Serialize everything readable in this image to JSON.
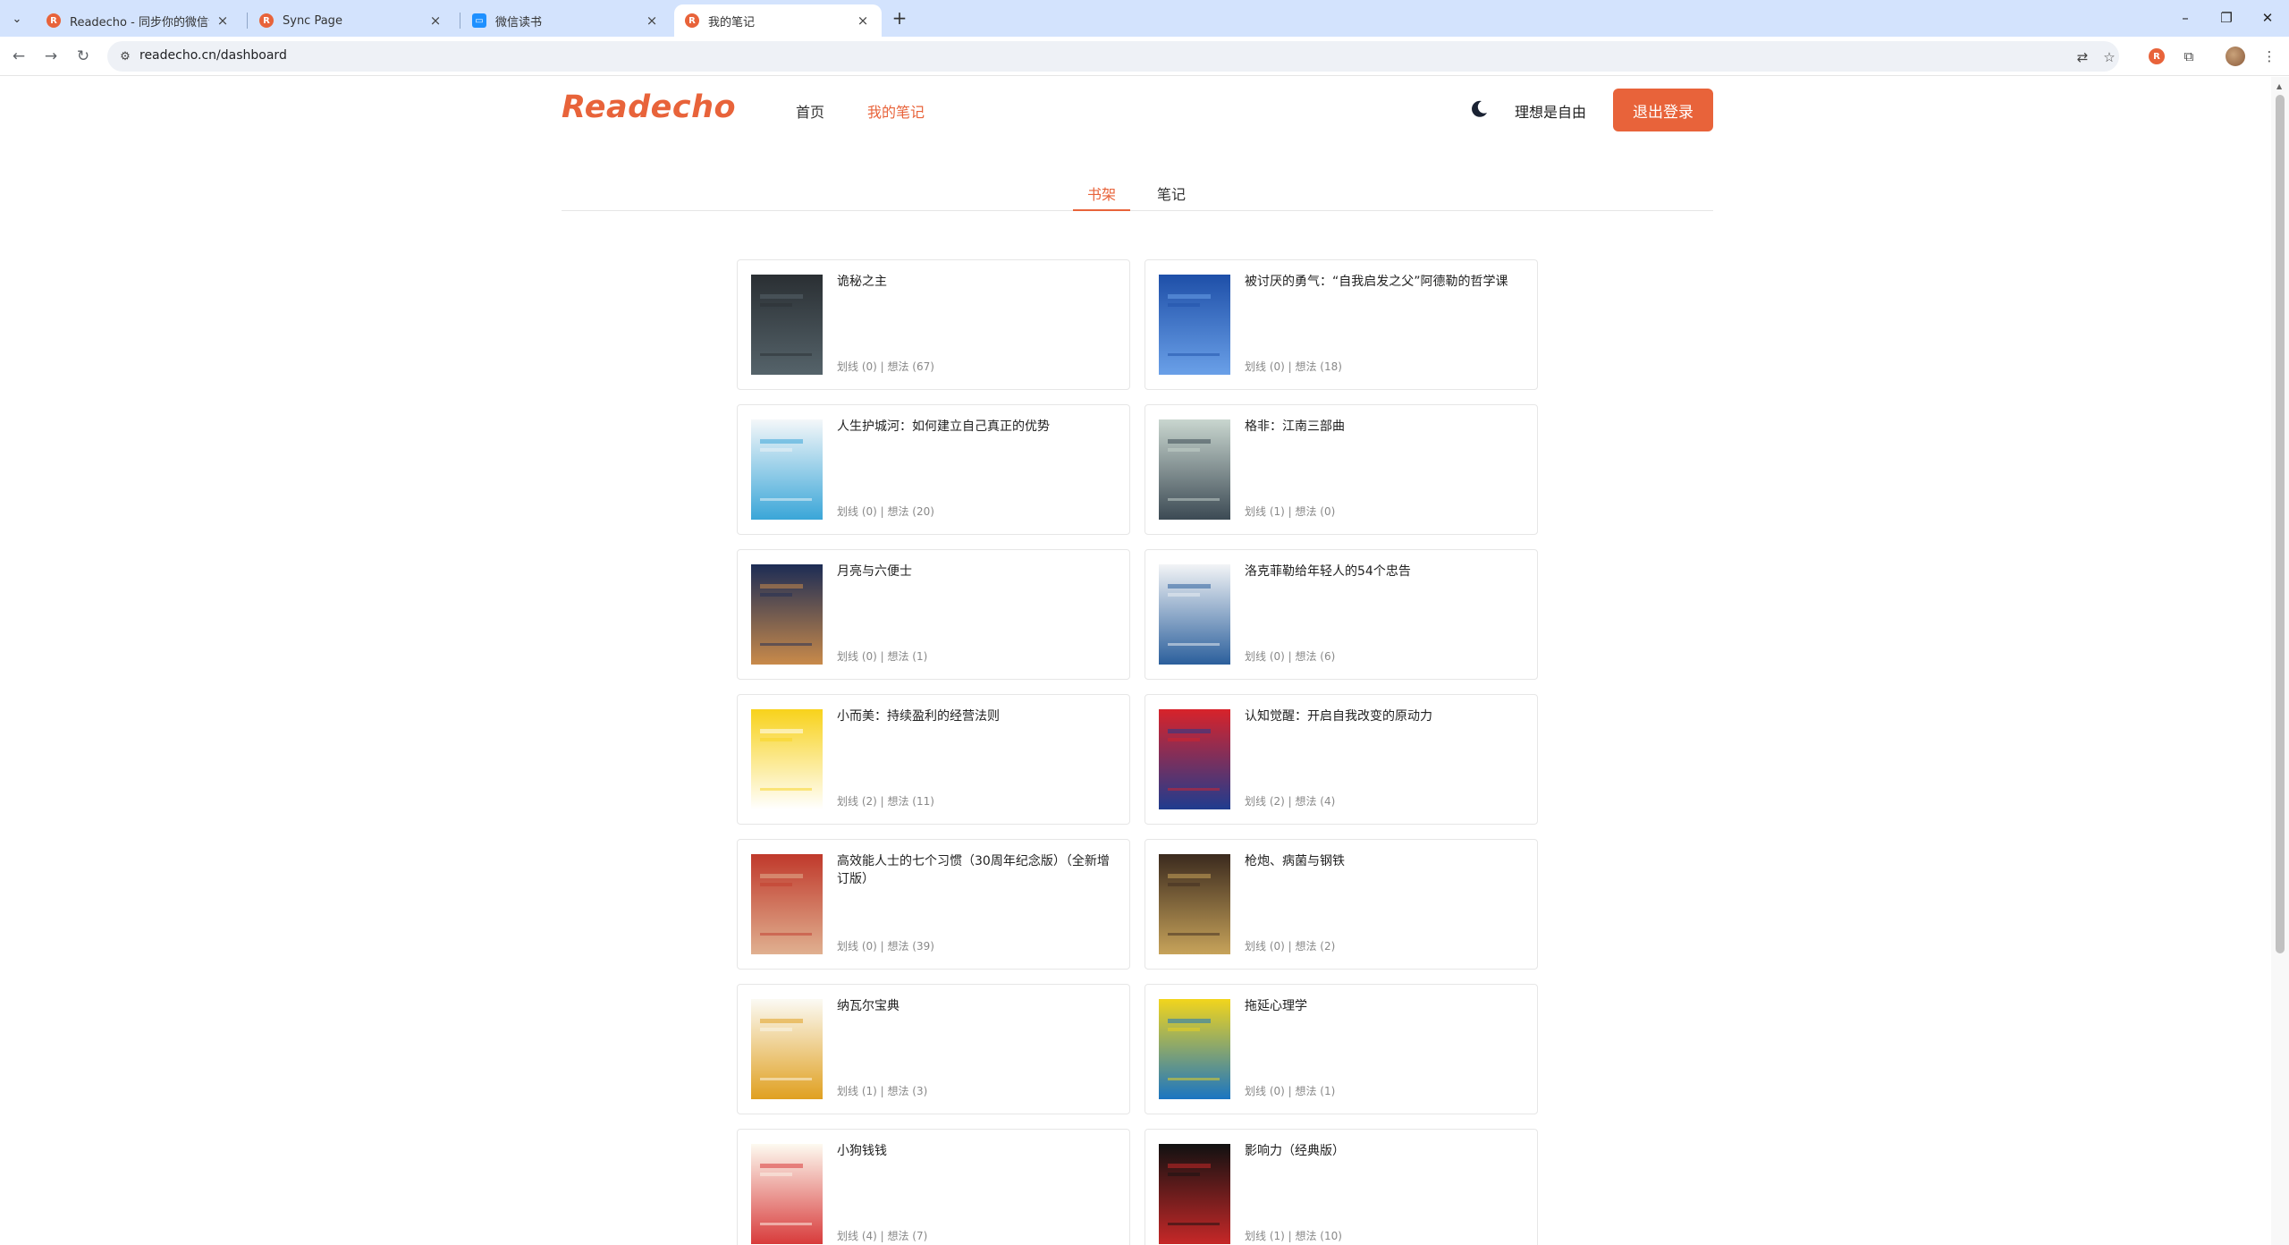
{
  "browser": {
    "tabs": [
      {
        "title": "Readecho - 同步你的微信读书",
        "favicon": "readecho-icon",
        "active": false
      },
      {
        "title": "Sync Page",
        "favicon": "readecho-icon",
        "active": false
      },
      {
        "title": "微信读书",
        "favicon": "weread-icon",
        "active": false
      },
      {
        "title": "我的笔记",
        "favicon": "readecho-icon",
        "active": true
      }
    ],
    "url": "readecho.cn/dashboard"
  },
  "site": {
    "logo": "Readecho",
    "nav": [
      {
        "label": "首页",
        "active": false
      },
      {
        "label": "我的笔记",
        "active": true
      }
    ],
    "username": "理想是自由",
    "logout_label": "退出登录",
    "accent_color": "#e8633a"
  },
  "subtabs": [
    {
      "label": "书架",
      "active": true
    },
    {
      "label": "笔记",
      "active": false
    }
  ],
  "books": [
    {
      "title": "诡秘之主",
      "stats": "划线 (0) | 想法 (67)",
      "cover_colors": [
        "#2a2f33",
        "#55636a"
      ]
    },
    {
      "title": "被讨厌的勇气：“自我启发之父”阿德勒的哲学课",
      "stats": "划线 (0) | 想法 (18)",
      "cover_colors": [
        "#1e4fa8",
        "#6aa0e8"
      ]
    },
    {
      "title": "人生护城河：如何建立自己真正的优势",
      "stats": "划线 (0) | 想法 (20)",
      "cover_colors": [
        "#f4f7f9",
        "#3aa6d8"
      ]
    },
    {
      "title": "格非：江南三部曲",
      "stats": "划线 (1) | 想法 (0)",
      "cover_colors": [
        "#c9d6cf",
        "#3c4a54"
      ]
    },
    {
      "title": "月亮与六便士",
      "stats": "划线 (0) | 想法 (1)",
      "cover_colors": [
        "#1c2c55",
        "#c98a4a"
      ]
    },
    {
      "title": "洛克菲勒给年轻人的54个忠告",
      "stats": "划线 (0) | 想法 (6)",
      "cover_colors": [
        "#f2f4f6",
        "#2b5f9c"
      ]
    },
    {
      "title": "小而美：持续盈利的经营法则",
      "stats": "划线 (2) | 想法 (11)",
      "cover_colors": [
        "#f8d21b",
        "#ffffff"
      ]
    },
    {
      "title": "认知觉醒：开启自我改变的原动力",
      "stats": "划线 (2) | 想法 (4)",
      "cover_colors": [
        "#d8232a",
        "#1f3c8f"
      ]
    },
    {
      "title": "高效能人士的七个习惯（30周年纪念版）（全新增订版）",
      "stats": "划线 (0) | 想法 (39)",
      "cover_colors": [
        "#c0392b",
        "#e0b090"
      ]
    },
    {
      "title": "枪炮、病菌与钢铁",
      "stats": "划线 (0) | 想法 (2)",
      "cover_colors": [
        "#3b2a1e",
        "#c7a35a"
      ]
    },
    {
      "title": "纳瓦尔宝典",
      "stats": "划线 (1) | 想法 (3)",
      "cover_colors": [
        "#fbfaf4",
        "#e0a020"
      ]
    },
    {
      "title": "拖延心理学",
      "stats": "划线 (0) | 想法 (1)",
      "cover_colors": [
        "#f2d51c",
        "#1a75c2"
      ]
    },
    {
      "title": "小狗钱钱",
      "stats": "划线 (4) | 想法 (7)",
      "cover_colors": [
        "#fdfaf0",
        "#d83b3b"
      ]
    },
    {
      "title": "影响力（经典版）",
      "stats": "划线 (1) | 想法 (10)",
      "cover_colors": [
        "#111111",
        "#c62828"
      ]
    }
  ]
}
